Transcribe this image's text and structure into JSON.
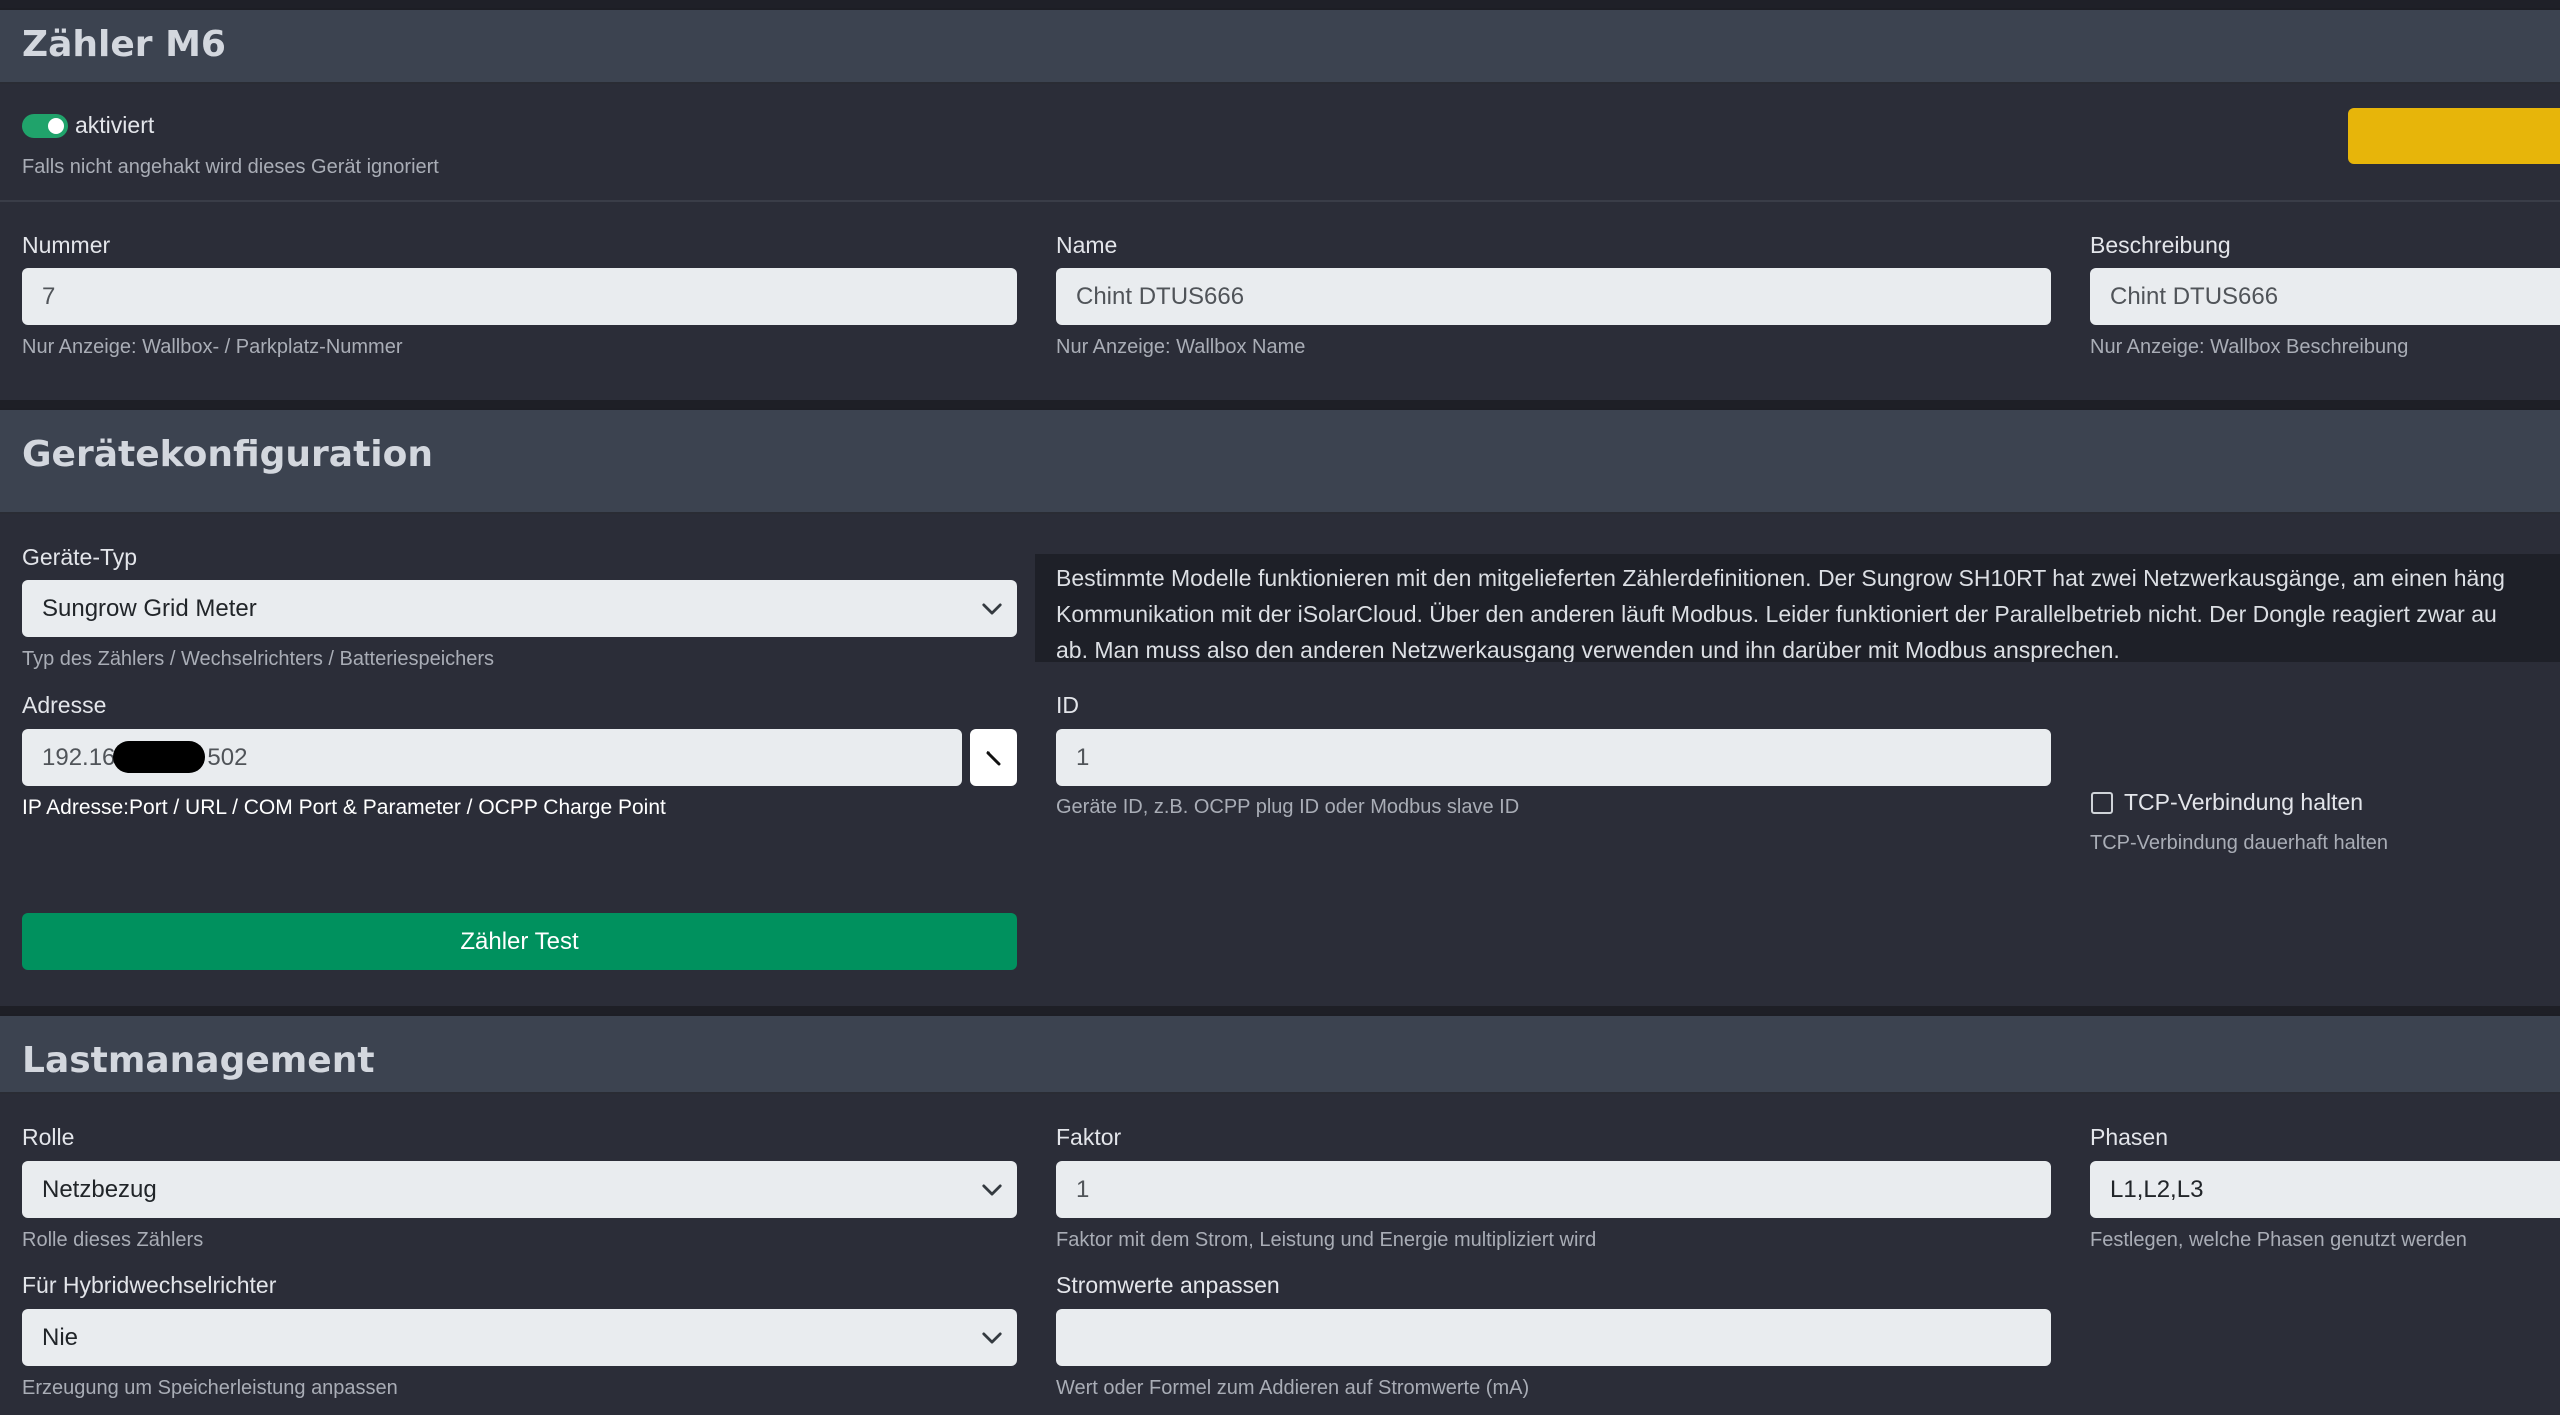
{
  "meter": {
    "title": "Zähler M6",
    "active_label": "aktiviert",
    "active_help": "Falls nicht angehakt wird dieses Gerät ignoriert",
    "active": true,
    "fields": {
      "nummer": {
        "label": "Nummer",
        "value": "7",
        "help": "Nur Anzeige: Wallbox- / Parkplatz-Nummer"
      },
      "name": {
        "label": "Name",
        "value": "Chint DTUS666",
        "help": "Nur Anzeige: Wallbox Name"
      },
      "beschreibung": {
        "label": "Beschreibung",
        "value": "Chint DTUS666",
        "help": "Nur Anzeige: Wallbox Beschreibung"
      }
    }
  },
  "device_config": {
    "title": "Gerätekonfiguration",
    "type": {
      "label": "Geräte-Typ",
      "value": "Sungrow Grid Meter",
      "help": "Typ des Zählers / Wechselrichters / Batteriespeichers"
    },
    "info_lines": [
      "Bestimmte Modelle funktionieren mit den mitgelieferten Zählerdefinitionen. Der Sungrow SH10RT hat zwei Netzwerkausgänge, am einen häng",
      "Kommunikation mit der iSolarCloud. Über den anderen läuft Modbus. Leider funktioniert der Parallelbetrieb nicht. Der Dongle reagiert zwar au",
      "ab. Man muss also den anderen Netzwerkausgang verwenden und ihn darüber mit Modbus ansprechen."
    ],
    "address": {
      "label": "Adresse",
      "value_prefix": "192.16",
      "value_suffix": "502",
      "help": "IP Adresse:Port / URL / COM Port & Parameter / OCPP Charge Point"
    },
    "id": {
      "label": "ID",
      "value": "1",
      "help": "Geräte ID, z.B. OCPP plug ID oder Modbus slave ID"
    },
    "tcp": {
      "label": "TCP-Verbindung halten",
      "help": "TCP-Verbindung dauerhaft halten",
      "checked": false
    },
    "test_button": "Zähler Test"
  },
  "load_management": {
    "title": "Lastmanagement",
    "rolle": {
      "label": "Rolle",
      "value": "Netzbezug",
      "help": "Rolle dieses Zählers"
    },
    "faktor": {
      "label": "Faktor",
      "value": "1",
      "help": "Faktor mit dem Strom, Leistung und Energie multipliziert wird"
    },
    "phasen": {
      "label": "Phasen",
      "value": "L1,L2,L3",
      "help": "Festlegen, welche Phasen genutzt werden"
    },
    "hybrid": {
      "label": "Für Hybridwechselrichter",
      "value": "Nie",
      "help": "Erzeugung um Speicherleistung anpassen"
    },
    "strom": {
      "label": "Stromwerte anpassen",
      "value": "",
      "help": "Wert oder Formel zum Addieren auf Stromwerte (mA)"
    }
  },
  "colors": {
    "background": "#2b2d38",
    "section_header": "#3c4350",
    "accent_green": "#00915e",
    "toggle_green": "#20a36b",
    "warning_yellow": "#e7b50a"
  }
}
